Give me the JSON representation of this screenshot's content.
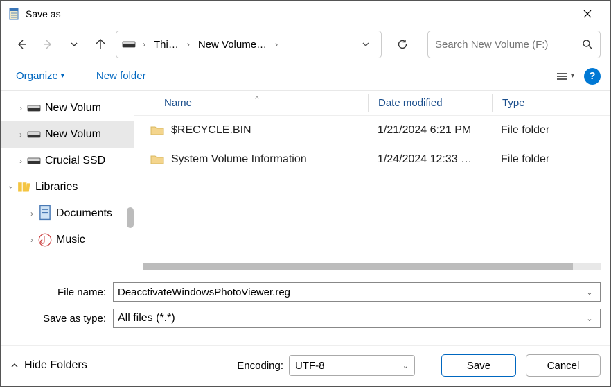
{
  "window": {
    "title": "Save as"
  },
  "breadcrumb": {
    "item1": "Thi…",
    "item2": "New Volume…"
  },
  "search": {
    "placeholder": "Search New Volume (F:)"
  },
  "toolbar": {
    "organize": "Organize",
    "new_folder": "New folder"
  },
  "tree": {
    "items": [
      {
        "label": "New Volum",
        "icon": "drive"
      },
      {
        "label": "New Volum",
        "icon": "drive",
        "selected": true
      },
      {
        "label": "Crucial SSD",
        "icon": "drive"
      },
      {
        "label": "Libraries",
        "icon": "libraries",
        "expanded": true,
        "level": 0
      },
      {
        "label": "Documents",
        "icon": "doc"
      },
      {
        "label": "Music",
        "icon": "music"
      }
    ]
  },
  "columns": {
    "name": "Name",
    "date": "Date modified",
    "type": "Type"
  },
  "files": [
    {
      "name": "$RECYCLE.BIN",
      "date": "1/21/2024 6:21 PM",
      "type": "File folder"
    },
    {
      "name": "System Volume Information",
      "date": "1/24/2024 12:33 …",
      "type": "File folder"
    }
  ],
  "form": {
    "filename_label": "File name:",
    "filename_value": "DeacctivateWindowsPhotoViewer.reg",
    "savetype_label": "Save as type:",
    "savetype_value": "All files  (*.*)"
  },
  "footer": {
    "hide_folders": "Hide Folders",
    "encoding_label": "Encoding:",
    "encoding_value": "UTF-8",
    "save": "Save",
    "cancel": "Cancel"
  }
}
